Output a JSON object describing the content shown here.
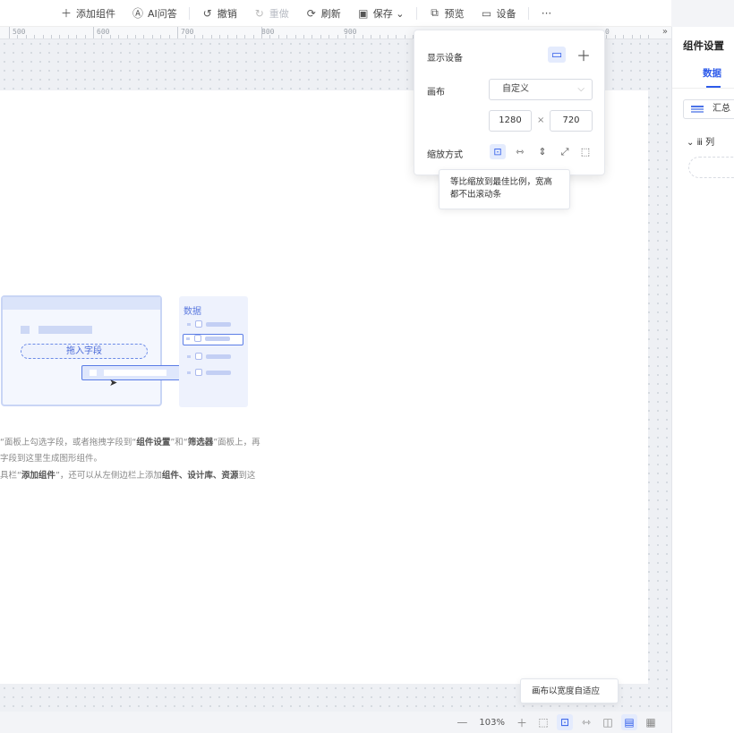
{
  "toolbar": {
    "items": [
      {
        "icon": "plus-icon",
        "glyph": "＋",
        "label": "添加组件",
        "disabled": false
      },
      {
        "icon": "ai-icon",
        "glyph": "Ⓐ",
        "label": "AI问答",
        "disabled": false
      },
      {
        "icon": "undo-icon",
        "glyph": "↺",
        "label": "撤销",
        "disabled": false
      },
      {
        "icon": "redo-icon",
        "glyph": "↻",
        "label": "重做",
        "disabled": true
      },
      {
        "icon": "refresh-icon",
        "glyph": "⟳",
        "label": "刷新",
        "disabled": false
      },
      {
        "icon": "save-icon",
        "glyph": "▣",
        "label": "保存 ⌄",
        "disabled": false
      },
      {
        "icon": "preview-icon",
        "glyph": "⧉",
        "label": "预览",
        "disabled": false
      },
      {
        "icon": "device-icon",
        "glyph": "▭",
        "label": "设备",
        "disabled": false
      },
      {
        "icon": "more-icon",
        "glyph": "···",
        "label": "",
        "disabled": false
      }
    ]
  },
  "ruler": {
    "labels": [
      "500",
      "600",
      "700",
      "800",
      "900",
      "0"
    ],
    "more": "»"
  },
  "illustration": {
    "drop_text": "拖入字段",
    "side_label": "数据"
  },
  "hints": [
    {
      "pre": "“面板上勾选字段，或者拖拽字段到“",
      "b1": "组件设置",
      "mid": "”和“",
      "b2": "筛选器",
      "post": "”面板上，再"
    },
    {
      "pre": "字段到这里生成图形组件。",
      "b1": "",
      "mid": "",
      "b2": "",
      "post": ""
    },
    {
      "pre": "具栏“",
      "b1": "添加组件",
      "mid": "”，还可以从左侧边栏上添加",
      "b2": "组件、设计库、资源",
      "post": "到这"
    }
  ],
  "device_popover": {
    "display_device_label": "显示设备",
    "canvas_label": "画布",
    "canvas_select": "自定义",
    "width": "1280",
    "times": "×",
    "height": "720",
    "scale_label": "缩放方式",
    "scale_tooltip": "等比缩放到最佳比例，宽高都不出滚动条"
  },
  "bottombar": {
    "zoom": "103%",
    "tooltip": "画布以宽度自适应"
  },
  "right_panel": {
    "title": "组件设置",
    "tab": "数据",
    "summary": "汇总",
    "column": "⌄  ⅲ 列"
  },
  "colors": {
    "accent": "#2e5bea",
    "canvas": "#ffffff",
    "workspace": "#eef0f4"
  }
}
